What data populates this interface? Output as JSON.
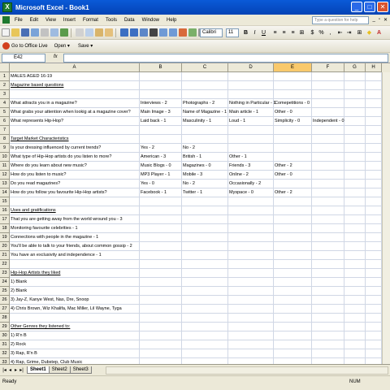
{
  "window": {
    "title": "Microsoft Excel - Book1",
    "app_icon": "X"
  },
  "menu": {
    "items": [
      "File",
      "Edit",
      "View",
      "Insert",
      "Format",
      "Tools",
      "Data",
      "Window",
      "Help"
    ],
    "help_placeholder": "Type a question for help"
  },
  "toolbar": {
    "font": "Calibri",
    "size": "11",
    "bold": "B",
    "italic": "I",
    "underline": "U"
  },
  "toolbar2": {
    "office_live": "Go to Office Live",
    "open": "Open ▾",
    "save": "Save ▾"
  },
  "namebox": "E42",
  "fx": "fx",
  "columns": [
    "A",
    "B",
    "C",
    "D",
    "E",
    "F",
    "G",
    "H"
  ],
  "rows": [
    {
      "n": "1",
      "cells": [
        "MALES AGED 16-19",
        "",
        "",
        "",
        "",
        "",
        "",
        ""
      ]
    },
    {
      "n": "2",
      "cells": [
        "Magazine based questions",
        "",
        "",
        "",
        "",
        "",
        "",
        ""
      ],
      "u": true
    },
    {
      "n": "3",
      "cells": [
        "",
        "",
        "",
        "",
        "",
        "",
        "",
        ""
      ]
    },
    {
      "n": "4",
      "cells": [
        "What attracts you in a magazine?",
        "Interviews - 2",
        "Photographs - 2",
        "Nothing in Particular - 1",
        "Comepetitions - 0",
        "",
        "",
        ""
      ]
    },
    {
      "n": "5",
      "cells": [
        "What grabs your attention when lookig at a magazine cover?",
        "Main Image - 3",
        "Name of Magazine - 1",
        "Main article - 1",
        "Other - 0",
        "",
        "",
        ""
      ]
    },
    {
      "n": "6",
      "cells": [
        "What represents Hip-Hop?",
        "Laid back - 1",
        "Masculinity - 1",
        "Loud - 1",
        "Simplicity - 0",
        "Independent - 0",
        "",
        ""
      ]
    },
    {
      "n": "7",
      "cells": [
        "",
        "",
        "",
        "",
        "",
        "",
        "",
        ""
      ]
    },
    {
      "n": "8",
      "cells": [
        "Target Market Characteristics",
        "",
        "",
        "",
        "",
        "",
        "",
        ""
      ],
      "u": true
    },
    {
      "n": "9",
      "cells": [
        "Is your dressing influenced by current trends?",
        "Yes - 2",
        "No - 2",
        "",
        "",
        "",
        "",
        ""
      ]
    },
    {
      "n": "10",
      "cells": [
        "What type of Hip-Hop artists do you listen to more?",
        "American - 3",
        "British - 1",
        "Other - 1",
        "",
        "",
        "",
        ""
      ]
    },
    {
      "n": "11",
      "cells": [
        "Where do you learn about new music?",
        "Music Blogs - 0",
        "Magazines - 0",
        "Friends - 3",
        "Other - 2",
        "",
        "",
        ""
      ]
    },
    {
      "n": "12",
      "cells": [
        "How do you listen to music?",
        "MP3 Player - 1",
        "Mobile - 3",
        "Online - 2",
        "Other - 0",
        "",
        "",
        ""
      ]
    },
    {
      "n": "13",
      "cells": [
        "Do you read magazines?",
        "Yes - 0",
        "No - 2",
        "Occasionally - 2",
        "",
        "",
        "",
        ""
      ]
    },
    {
      "n": "14",
      "cells": [
        "How do you follow you favourite Hip-Hop artists?",
        "Facebook - 1",
        "Twitter - 1",
        "Myspace - 0",
        "Other - 2",
        "",
        "",
        ""
      ]
    },
    {
      "n": "15",
      "cells": [
        "",
        "",
        "",
        "",
        "",
        "",
        "",
        ""
      ]
    },
    {
      "n": "16",
      "cells": [
        "Uses and gratifications",
        "",
        "",
        "",
        "",
        "",
        "",
        ""
      ],
      "u": true
    },
    {
      "n": "17",
      "cells": [
        "That you are getting away from the world wround you - 3",
        "",
        "",
        "",
        "",
        "",
        "",
        ""
      ]
    },
    {
      "n": "18",
      "cells": [
        "Monitoring favourite celebrities - 1",
        "",
        "",
        "",
        "",
        "",
        "",
        ""
      ]
    },
    {
      "n": "19",
      "cells": [
        "Connections with people in the magazine - 1",
        "",
        "",
        "",
        "",
        "",
        "",
        ""
      ]
    },
    {
      "n": "20",
      "cells": [
        "You'll be able to talk to your friends, about common gossip - 2",
        "",
        "",
        "",
        "",
        "",
        "",
        ""
      ]
    },
    {
      "n": "21",
      "cells": [
        "You have an exclusivity and independence - 1",
        "",
        "",
        "",
        "",
        "",
        "",
        ""
      ]
    },
    {
      "n": "22",
      "cells": [
        "",
        "",
        "",
        "",
        "",
        "",
        "",
        ""
      ]
    },
    {
      "n": "23",
      "cells": [
        "Hip-Hop Artists they liked",
        "",
        "",
        "",
        "",
        "",
        "",
        ""
      ],
      "u": true
    },
    {
      "n": "24",
      "cells": [
        "1) Blank",
        "",
        "",
        "",
        "",
        "",
        "",
        ""
      ]
    },
    {
      "n": "25",
      "cells": [
        "2) Blank",
        "",
        "",
        "",
        "",
        "",
        "",
        ""
      ]
    },
    {
      "n": "26",
      "cells": [
        "3) Jay-Z, Kanye West, Nas, Dre, Snoop",
        "",
        "",
        "",
        "",
        "",
        "",
        ""
      ]
    },
    {
      "n": "27",
      "cells": [
        "4) Chris Brown, Wiz Khalifa, Mac Miller, Lil Wayne, Tyga",
        "",
        "",
        "",
        "",
        "",
        "",
        ""
      ]
    },
    {
      "n": "28",
      "cells": [
        "",
        "",
        "",
        "",
        "",
        "",
        "",
        ""
      ]
    },
    {
      "n": "29",
      "cells": [
        "Other Genres they listened to:",
        "",
        "",
        "",
        "",
        "",
        "",
        ""
      ],
      "u": true
    },
    {
      "n": "30",
      "cells": [
        "1) R'n B",
        "",
        "",
        "",
        "",
        "",
        "",
        ""
      ]
    },
    {
      "n": "31",
      "cells": [
        "2) Rock",
        "",
        "",
        "",
        "",
        "",
        "",
        ""
      ]
    },
    {
      "n": "32",
      "cells": [
        "3) Rap, R'n B",
        "",
        "",
        "",
        "",
        "",
        "",
        ""
      ]
    },
    {
      "n": "33",
      "cells": [
        "4) Rap, Grime, Dubstep, Club Music",
        "",
        "",
        "",
        "",
        "",
        "",
        ""
      ]
    }
  ],
  "sheets": [
    "Sheet1",
    "Sheet2",
    "Sheet3"
  ],
  "status": {
    "left": "Ready",
    "right": "NUM"
  }
}
